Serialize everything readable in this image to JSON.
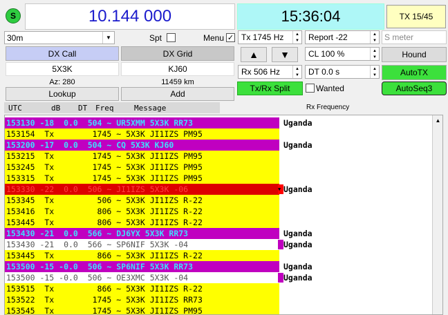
{
  "status_icon": "S",
  "frequency": "10.144 000",
  "clock": "15:36:04",
  "tx_counter": "TX 15/45",
  "band": "30m",
  "spt_label": "Spt",
  "menu_label": "Menu",
  "tx_freq": "Tx  1745  Hz",
  "rx_freq": "Rx  506  Hz",
  "report": "Report -22",
  "cl": "CL  100 %",
  "dt": "DT 0.0 s",
  "s_meter": "S meter",
  "dx_call_label": "DX Call",
  "dx_grid_label": "DX Grid",
  "dx_call": "5X3K",
  "dx_grid": "KJ60",
  "azimuth": "Az: 280",
  "distance": "11459 km",
  "lookup_label": "Lookup",
  "add_label": "Add",
  "up_arrow": "▲",
  "down_arrow": "▼",
  "hound_label": "Hound",
  "autotx_label": "AutoTX",
  "autoseq_label": "AutoSeq3",
  "txrx_split_label": "Tx/Rx Split",
  "wanted_label": "Wanted",
  "rx_frequency_label": "Rx Frequency",
  "colors": {
    "magenta": "#c000c0",
    "yellow": "#ffff00",
    "red_row": "#e00000",
    "green_btn": "#3ce03c"
  },
  "headers": [
    "UTC",
    "dB",
    "DT",
    "Freq",
    "Message"
  ],
  "rows": [
    {
      "text": "153130 -18  0.0  504 ~ UR5XMM 5X3K RR73",
      "country": "Uganda",
      "style": "mag"
    },
    {
      "text": "153154  Tx        1745 ~ 5X3K JI1IZS PM95",
      "country": "",
      "style": "yel"
    },
    {
      "text": "153200 -17  0.0  504 ~ CQ 5X3K KJ60",
      "country": "Uganda",
      "style": "mag"
    },
    {
      "text": "153215  Tx        1745 ~ 5X3K JI1IZS PM95",
      "country": "",
      "style": "yel"
    },
    {
      "text": "153245  Tx        1745 ~ 5X3K JI1IZS PM95",
      "country": "",
      "style": "yel"
    },
    {
      "text": "153315  Tx        1745 ~ 5X3K JI1IZS PM95",
      "country": "",
      "style": "yel"
    },
    {
      "text": "153330 -22  0.0  506 ~ JI1IZS 5X3K -06",
      "country": "Uganda",
      "style": "red"
    },
    {
      "text": "153345  Tx         506 ~ 5X3K JI1IZS R-22",
      "country": "",
      "style": "yel"
    },
    {
      "text": "153416  Tx         806 ~ 5X3K JI1IZS R-22",
      "country": "",
      "style": "yel"
    },
    {
      "text": "153445  Tx         806 ~ 5X3K JI1IZS R-22",
      "country": "",
      "style": "yel"
    },
    {
      "text": "153430 -21  0.0  566 ~ DJ6YX 5X3K RR73",
      "country": "Uganda",
      "style": "mag"
    },
    {
      "text": "153430 -21  0.0  566 ~ SP6NIF 5X3K -04",
      "country": "Uganda",
      "style": "wht"
    },
    {
      "text": "153445  Tx         866 ~ 5X3K JI1IZS R-22",
      "country": "",
      "style": "yel"
    },
    {
      "text": "153500 -15 -0.0  506 ~ SP6NIF 5X3K RR73",
      "country": "Uganda",
      "style": "mag"
    },
    {
      "text": "153500 -15 -0.0  506 ~ OE3XMC 5X3K -04",
      "country": "Uganda",
      "style": "wht"
    },
    {
      "text": "153515  Tx         866 ~ 5X3K JI1IZS R-22",
      "country": "",
      "style": "yel"
    },
    {
      "text": "153522  Tx        1745 ~ 5X3K JI1IZS RR73",
      "country": "",
      "style": "yel"
    },
    {
      "text": "153545  Tx        1745 ~ 5X3K JI1IZS PM95",
      "country": "",
      "style": "yel"
    }
  ]
}
